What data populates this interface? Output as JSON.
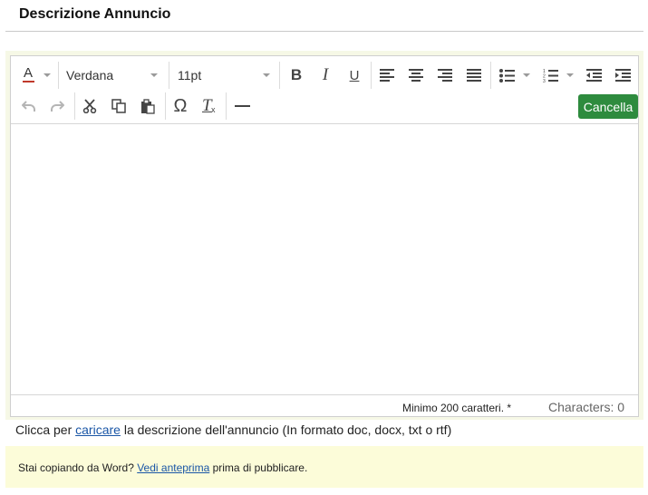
{
  "header": {
    "title": "Descrizione Annuncio"
  },
  "toolbar": {
    "font_family": "Verdana",
    "font_size": "11pt",
    "text_color_label": "A",
    "cancel_label": "Cancella",
    "accent_color": "#2e8b3e",
    "icons": [
      "text-color-icon",
      "bold-icon",
      "italic-icon",
      "underline-icon",
      "align-left-icon",
      "align-center-icon",
      "align-right-icon",
      "align-justify-icon",
      "bullet-list-icon",
      "numbered-list-icon",
      "outdent-icon",
      "indent-icon",
      "undo-icon",
      "redo-icon",
      "cut-icon",
      "copy-icon",
      "paste-icon",
      "special-char-icon",
      "clear-format-icon",
      "horizontal-rule-icon"
    ]
  },
  "editor": {
    "content": ""
  },
  "statusbar": {
    "min_chars": "Minimo 200 caratteri. *",
    "characters": "Characters: 0"
  },
  "upload": {
    "prefix": "Clicca per ",
    "link": "caricare",
    "suffix": " la descrizione dell'annuncio (In formato doc, docx, txt o rtf)"
  },
  "note": {
    "prefix": "Stai copiando da Word? ",
    "link": "Vedi anteprima",
    "suffix": " prima di pubblicare.",
    "background": "#fcfcd9"
  }
}
